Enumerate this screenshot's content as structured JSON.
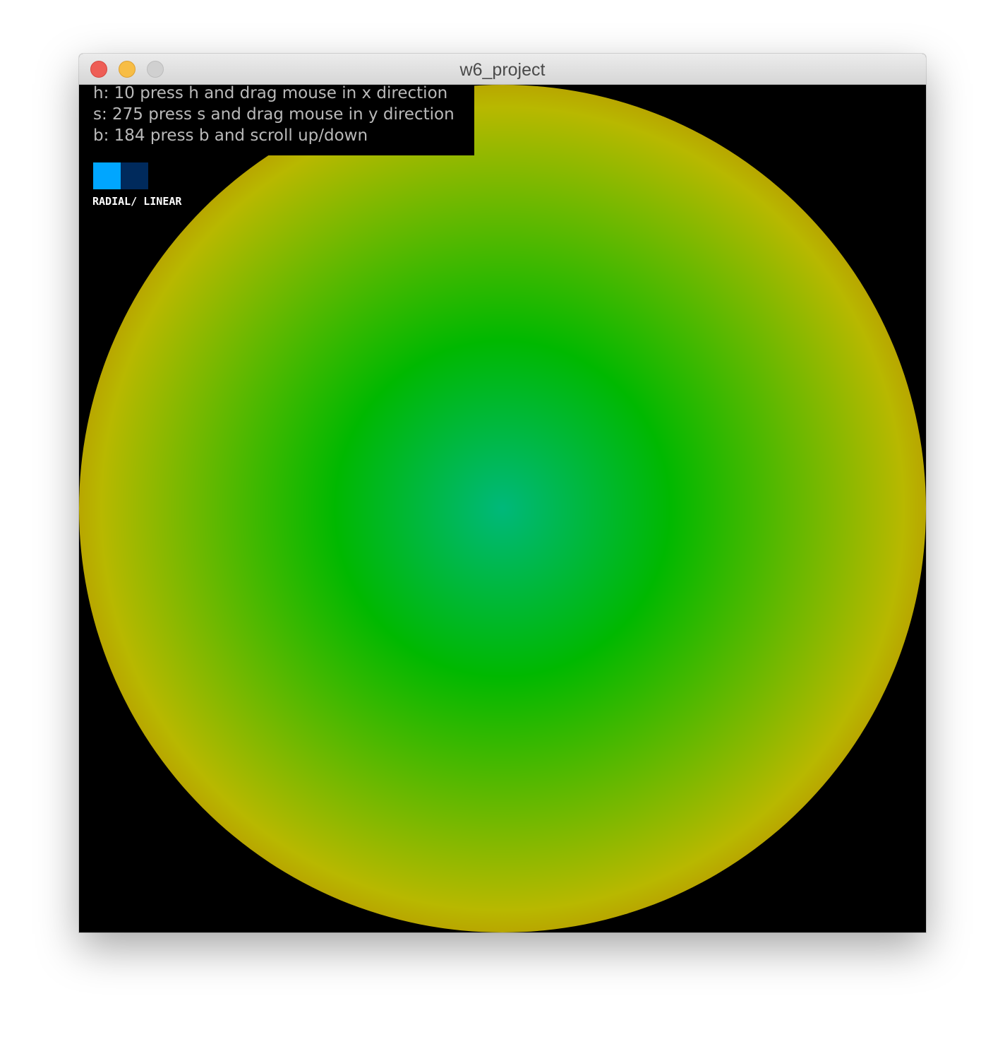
{
  "window": {
    "title": "w6_project"
  },
  "info": {
    "lines": [
      "h: 10 press h and drag mouse in x direction",
      "s: 275 press s and drag mouse in y direction",
      "b: 184 press b and scroll up/down"
    ],
    "text_color": "#b9b9b9"
  },
  "toggle": {
    "label": "RADIAL/ LINEAR",
    "active_color": "#00a6ff",
    "inactive_color": "#002a5c",
    "active_option": "radial"
  },
  "gradient": {
    "type": "radial",
    "colors": [
      "#00b87a",
      "#00b800",
      "#b8b800",
      "#b81d00"
    ]
  },
  "icons": [
    "close-icon",
    "minimize-icon",
    "zoom-icon"
  ]
}
